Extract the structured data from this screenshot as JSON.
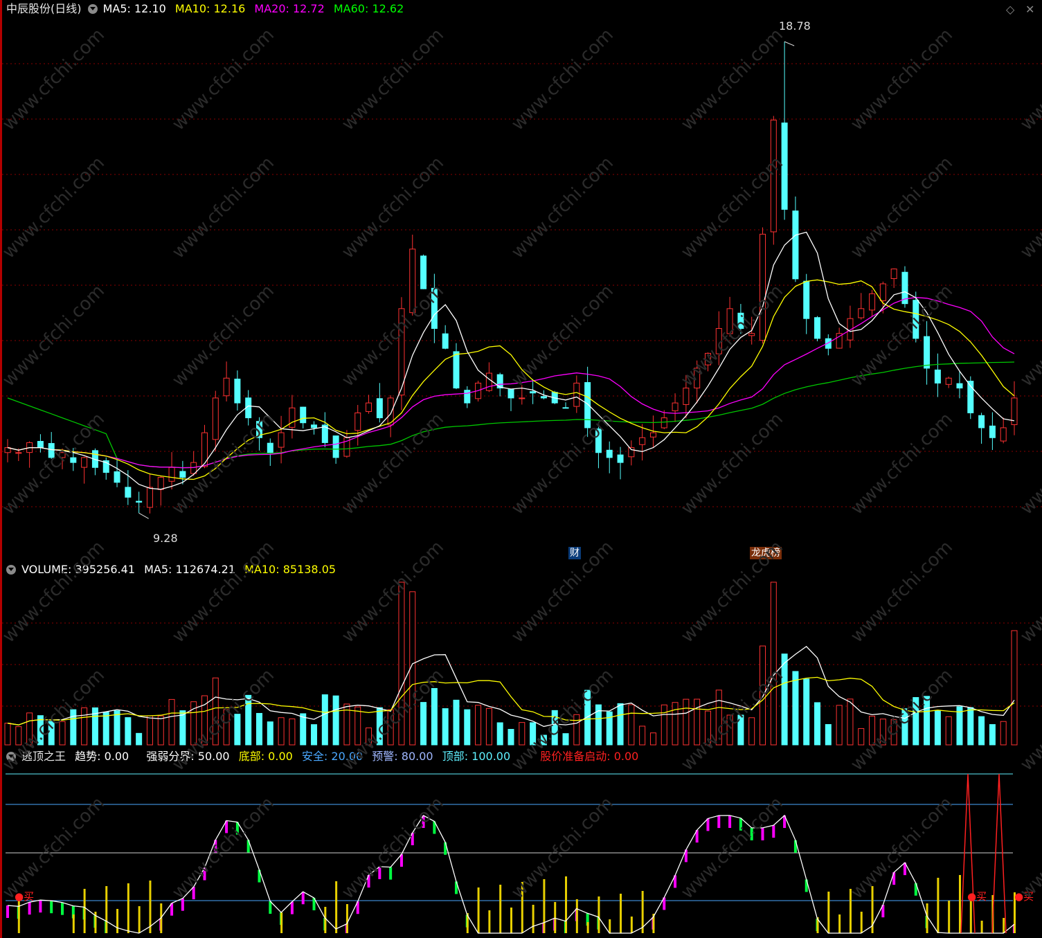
{
  "price_header": {
    "name": "中辰股份(日线)",
    "ma5": "MA5: 12.10",
    "ma10": "MA10: 12.16",
    "ma20": "MA20: 12.72",
    "ma60": "MA60: 12.62"
  },
  "volume_header": {
    "volume": "VOLUME: 395256.41",
    "ma5": "MA5: 112674.21",
    "ma10": "MA10: 85138.05"
  },
  "indicator_header": {
    "name": "逃顶之王",
    "trend": "趋势: 0.00",
    "strong_weak": "强弱分界: 50.00",
    "bottom": "底部: 0.00",
    "safe": "安全: 20.00",
    "warn": "预警: 80.00",
    "top": "顶部: 100.00",
    "start": "股价准备启动: 0.00"
  },
  "annotations": {
    "high": "18.78",
    "low": "9.28",
    "tag_cai": "财",
    "tag_bang": "龙虎榜",
    "buy1": "买",
    "buy2": "买",
    "buy3": "买"
  },
  "watermark": "www.cfchi.com",
  "corner_icons": [
    "diamond-icon",
    "close-icon"
  ],
  "colors": {
    "up": "#ff3232",
    "down": "#54ffff",
    "ma5": "#ffffff",
    "ma10": "#ffff00",
    "ma20": "#ff00ff",
    "ma60": "#00c800",
    "grid": "#8b0000"
  },
  "chart_data": {
    "type": "candlestick",
    "close_prices": [
      10.6,
      10.5,
      10.7,
      10.6,
      10.4,
      10.5,
      10.3,
      10.4,
      10.2,
      10.1,
      9.9,
      9.6,
      9.5,
      9.8,
      10.0,
      10.2,
      10.0,
      10.3,
      10.9,
      11.6,
      12.0,
      11.5,
      11.2,
      10.8,
      10.5,
      10.9,
      11.4,
      11.1,
      11.0,
      10.7,
      10.4,
      10.8,
      11.3,
      11.5,
      11.2,
      11.6,
      13.4,
      14.6,
      13.8,
      13.0,
      12.6,
      11.8,
      11.5,
      11.9,
      12.1,
      11.8,
      11.6,
      11.6,
      11.7,
      11.6,
      11.5,
      11.4,
      11.9,
      11.0,
      10.5,
      10.4,
      10.3,
      10.6,
      10.8,
      10.9,
      11.2,
      11.5,
      11.8,
      12.2,
      12.5,
      13.0,
      13.4,
      13.0,
      12.9,
      14.9,
      17.2,
      15.4,
      14.0,
      13.2,
      12.8,
      12.6,
      12.9,
      13.2,
      13.4,
      13.7,
      13.9,
      14.2,
      13.5,
      12.8,
      12.2,
      11.9,
      12.0,
      11.8,
      11.3,
      11.0,
      10.8,
      11.0,
      11.6
    ]
  }
}
